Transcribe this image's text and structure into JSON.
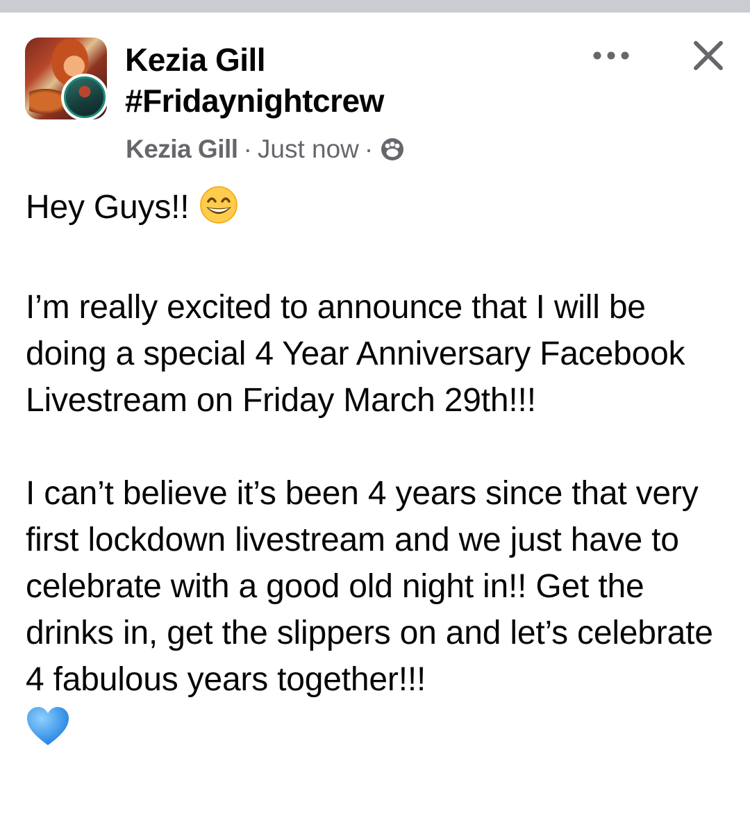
{
  "post": {
    "author_name": "Kezia Gill",
    "group_name": "#Fridaynightcrew",
    "meta": {
      "author": "Kezia Gill",
      "separator": "·",
      "time": "Just now",
      "audience_icon": "group-audience-icon"
    },
    "icons": {
      "more": "more-horizontal-icon",
      "close": "close-icon"
    },
    "body": {
      "greeting": "Hey Guys!!",
      "greeting_emoji": "grinning-face-emoji",
      "para2": "I’m really excited to announce that I will be doing a special 4 Year Anniversary Facebook Livestream on Friday March 29th!!!",
      "para3": "I can’t believe it’s been 4 years since that very first lockdown livestream and we just have to celebrate with a good old night in!! Get the drinks in, get the slippers on and let’s celebrate 4 fabulous years together!!!",
      "closing_emoji": "blue-heart-emoji"
    }
  }
}
